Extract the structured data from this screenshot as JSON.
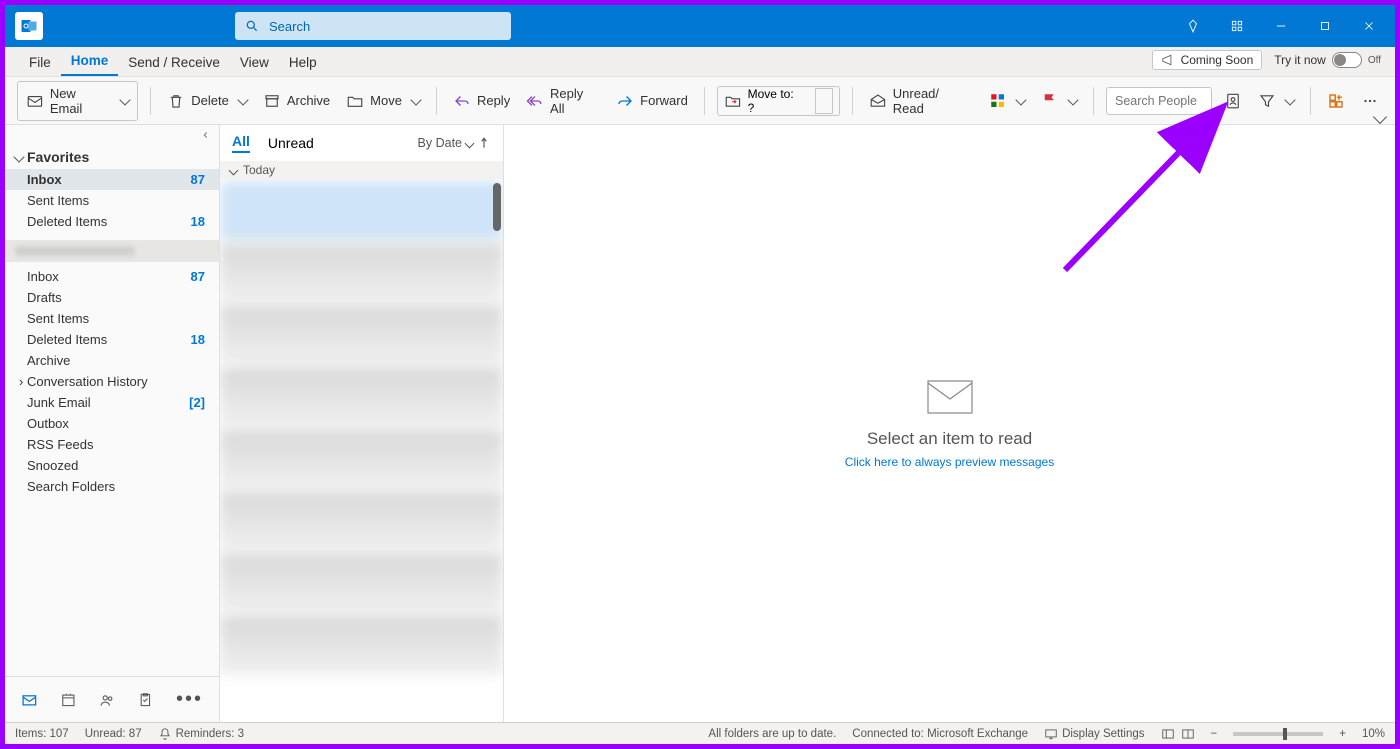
{
  "titlebar": {
    "search_placeholder": "Search"
  },
  "menu": {
    "items": [
      "File",
      "Home",
      "Send / Receive",
      "View",
      "Help"
    ],
    "coming_soon": "Coming Soon",
    "try_it_now": "Try it now",
    "toggle_label": "Off"
  },
  "ribbon": {
    "new_email": "New Email",
    "delete": "Delete",
    "archive": "Archive",
    "move": "Move",
    "reply": "Reply",
    "reply_all": "Reply All",
    "forward": "Forward",
    "move_to": "Move to: ?",
    "unread_read": "Unread/ Read",
    "search_people_placeholder": "Search People"
  },
  "folders": {
    "favorites": "Favorites",
    "items": [
      {
        "label": "Inbox",
        "count": "87",
        "selected": true
      },
      {
        "label": "Sent Items",
        "count": ""
      },
      {
        "label": "Deleted Items",
        "count": "18"
      }
    ],
    "account_items": [
      {
        "label": "Inbox",
        "count": "87"
      },
      {
        "label": "Drafts",
        "count": ""
      },
      {
        "label": "Sent Items",
        "count": ""
      },
      {
        "label": "Deleted Items",
        "count": "18"
      },
      {
        "label": "Archive",
        "count": ""
      },
      {
        "label": "Conversation History",
        "count": "",
        "chev": true
      },
      {
        "label": "Junk Email",
        "count": "[2]"
      },
      {
        "label": "Outbox",
        "count": ""
      },
      {
        "label": "RSS Feeds",
        "count": ""
      },
      {
        "label": "Snoozed",
        "count": ""
      },
      {
        "label": "Search Folders",
        "count": ""
      }
    ]
  },
  "msglist": {
    "tab_all": "All",
    "tab_unread": "Unread",
    "by_date": "By Date",
    "group_today": "Today"
  },
  "reading": {
    "title": "Select an item to read",
    "link": "Click here to always preview messages"
  },
  "status": {
    "items": "Items: 107",
    "unread": "Unread: 87",
    "reminders": "Reminders: 3",
    "sync": "All folders are up to date.",
    "connected": "Connected to: Microsoft Exchange",
    "display": "Display Settings",
    "zoom": "10%"
  }
}
